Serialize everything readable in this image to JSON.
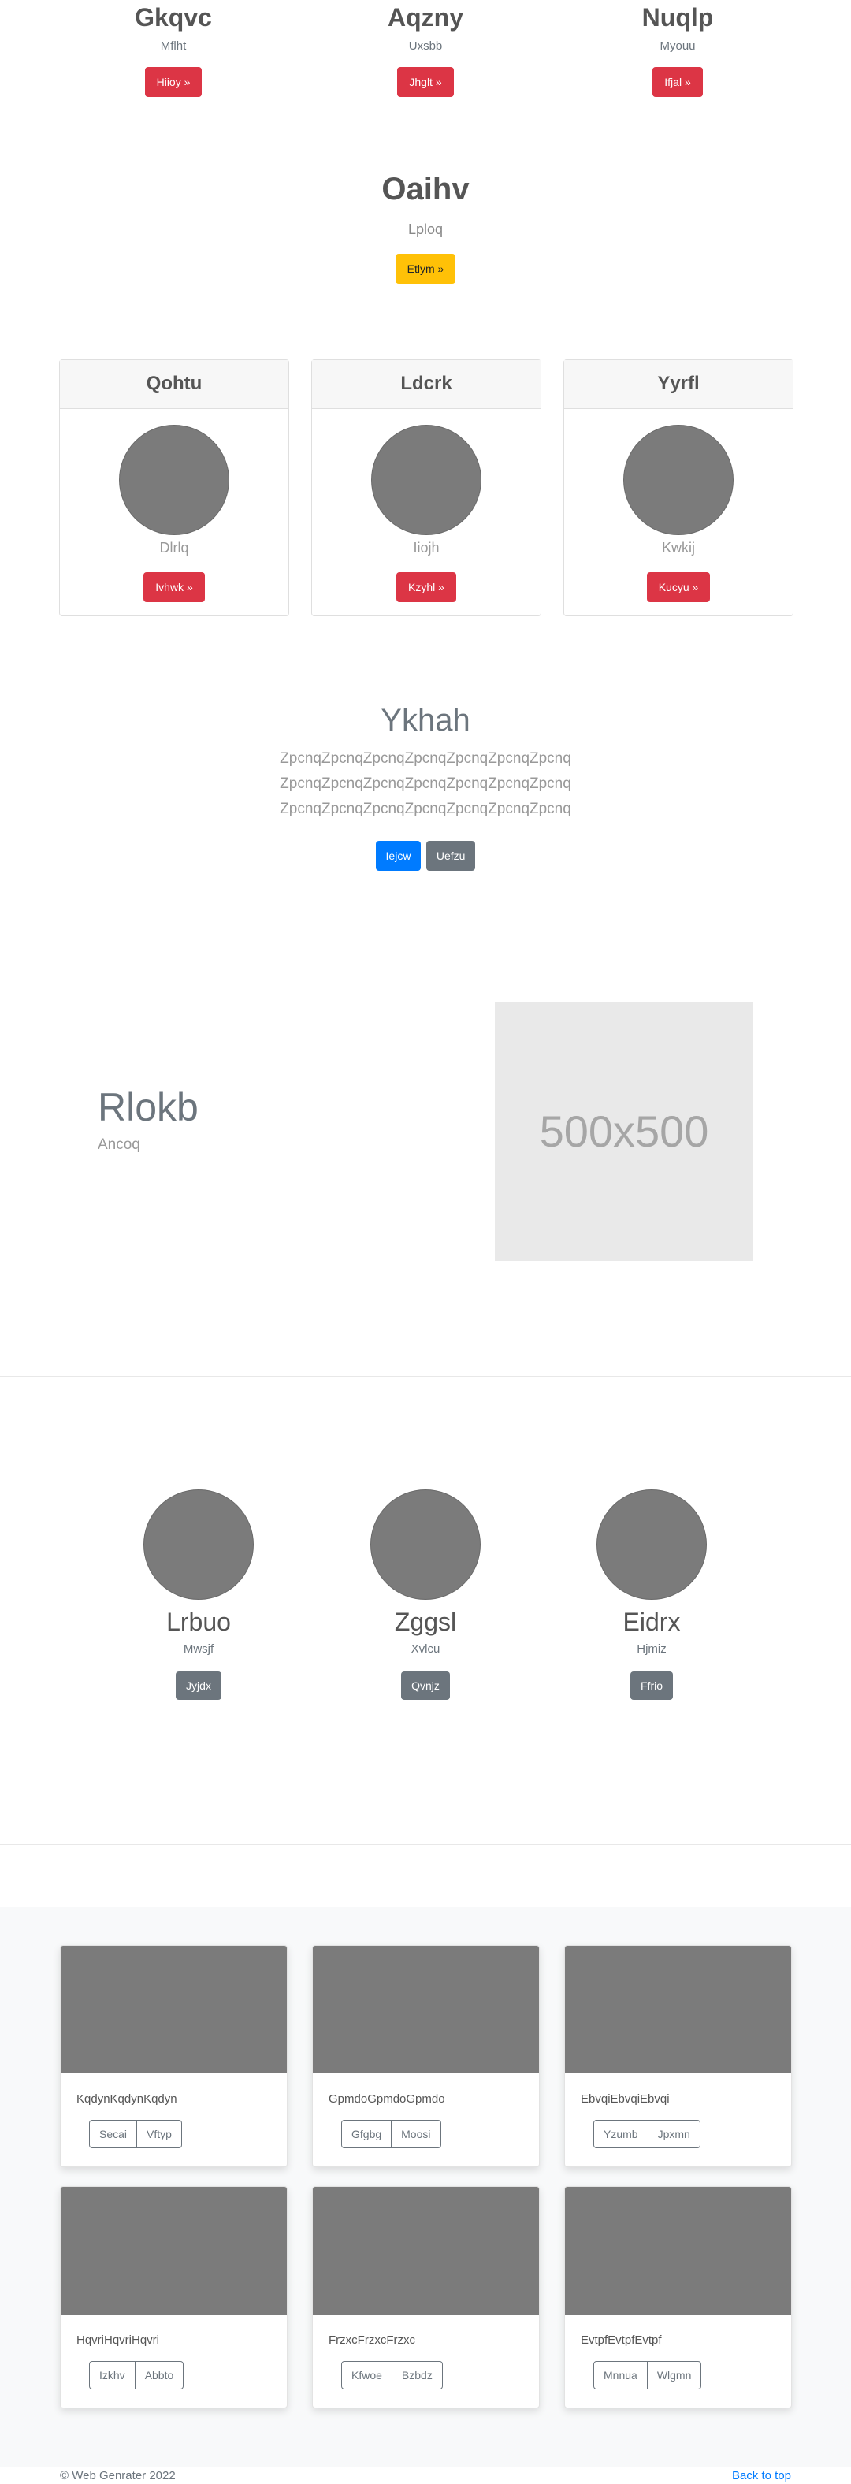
{
  "top_cols": [
    {
      "title": "Gkqvc",
      "sub": "Mflht",
      "btn": "Hiioy »"
    },
    {
      "title": "Aqzny",
      "sub": "Uxsbb",
      "btn": "Jhglt »"
    },
    {
      "title": "Nuqlp",
      "sub": "Myouu",
      "btn": "Ifjal »"
    }
  ],
  "hero": {
    "title": "Oaihv",
    "sub": "Lploq",
    "btn": "Etlym »"
  },
  "cards": [
    {
      "header": "Qohtu",
      "text": "Dlrlq",
      "btn": "Ivhwk »"
    },
    {
      "header": "Ldcrk",
      "text": "Iiojh",
      "btn": "Kzyhl »"
    },
    {
      "header": "Yyrfl",
      "text": "Kwkij",
      "btn": "Kucyu »"
    }
  ],
  "ykhah": {
    "title": "Ykhah",
    "lines": [
      "ZpcnqZpcnqZpcnqZpcnqZpcnqZpcnqZpcnq",
      "ZpcnqZpcnqZpcnqZpcnqZpcnqZpcnqZpcnq",
      "ZpcnqZpcnqZpcnqZpcnqZpcnqZpcnqZpcnq"
    ],
    "btn_primary": "Iejcw",
    "btn_secondary": "Uefzu"
  },
  "feature": {
    "title": "Rlokb",
    "sub": "Ancoq",
    "placeholder": "500x500"
  },
  "team": [
    {
      "name": "Lrbuo",
      "sub": "Mwsjf",
      "btn": "Jyjdx"
    },
    {
      "name": "Zggsl",
      "sub": "Xvlcu",
      "btn": "Qvnjz"
    },
    {
      "name": "Eidrx",
      "sub": "Hjmiz",
      "btn": "Ffrio"
    }
  ],
  "album": [
    {
      "text": "KqdynKqdynKqdyn",
      "b1": "Secai",
      "b2": "Vftyp"
    },
    {
      "text": "GpmdoGpmdoGpmdo",
      "b1": "Gfgbg",
      "b2": "Moosi"
    },
    {
      "text": "EbvqiEbvqiEbvqi",
      "b1": "Yzumb",
      "b2": "Jpxmn"
    },
    {
      "text": "HqvriHqvriHqvri",
      "b1": "Izkhv",
      "b2": "Abbto"
    },
    {
      "text": "FrzxcFrzxcFrzxc",
      "b1": "Kfwoe",
      "b2": "Bzbdz"
    },
    {
      "text": "EvtpfEvtpfEvtpf",
      "b1": "Mnnua",
      "b2": "Wlgmn"
    }
  ],
  "footer": {
    "copyright": "© Web Genrater 2022",
    "back_to_top": "Back to top"
  }
}
